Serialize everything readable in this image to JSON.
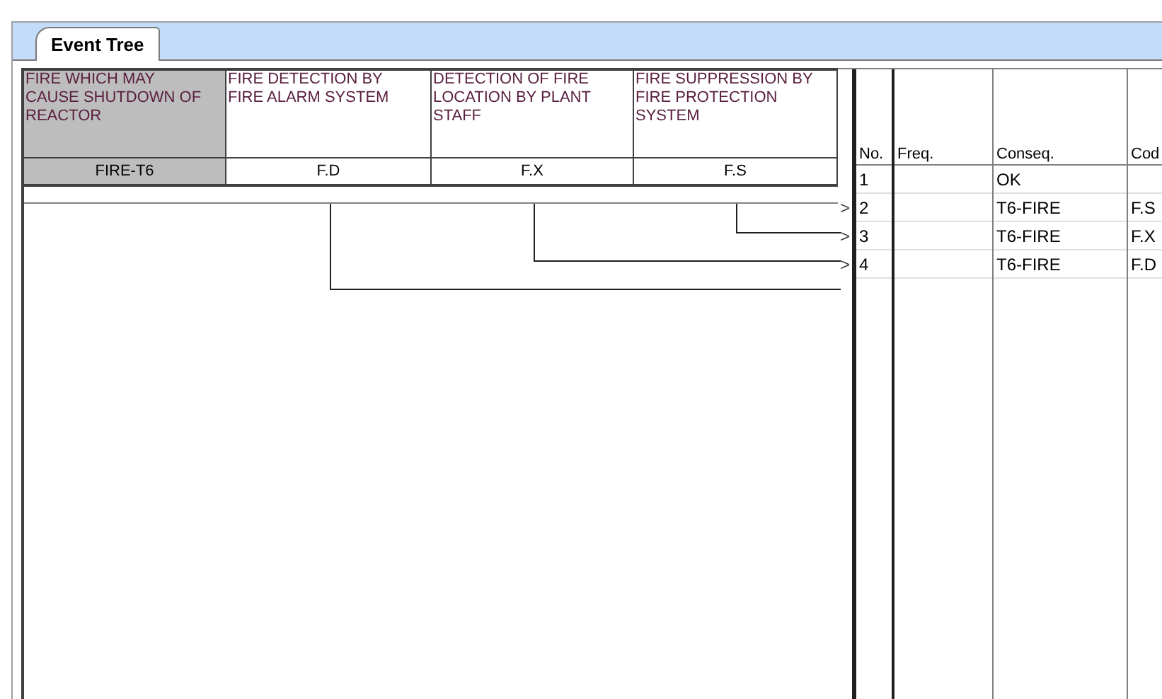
{
  "tabs": [
    {
      "label": "Event Tree",
      "selected": true
    }
  ],
  "events": [
    {
      "title": "FIRE WHICH MAY CAUSE SHUTDOWN OF REACTOR",
      "code": "FIRE-T6",
      "kind": "initiator"
    },
    {
      "title": "FIRE DETECTION BY FIRE ALARM SYSTEM",
      "code": "F.D",
      "kind": "function"
    },
    {
      "title": "DETECTION OF FIRE LOCATION BY PLANT STAFF",
      "code": "F.X",
      "kind": "function"
    },
    {
      "title": "FIRE SUPPRESSION BY FIRE PROTECTION SYSTEM",
      "code": "F.S",
      "kind": "function"
    }
  ],
  "columns": [
    "No.",
    "Freq.",
    "Conseq.",
    "Cod"
  ],
  "sequences": [
    {
      "no": "1",
      "conseq": "OK"
    },
    {
      "marker": ">",
      "no": "2",
      "conseq": "T6-FIRE",
      "code": "F.S"
    },
    {
      "marker": ">",
      "no": "3",
      "conseq": "T6-FIRE",
      "code": "F.X"
    },
    {
      "marker": ">",
      "no": "4",
      "conseq": "T6-FIRE",
      "code": "F.D"
    }
  ]
}
